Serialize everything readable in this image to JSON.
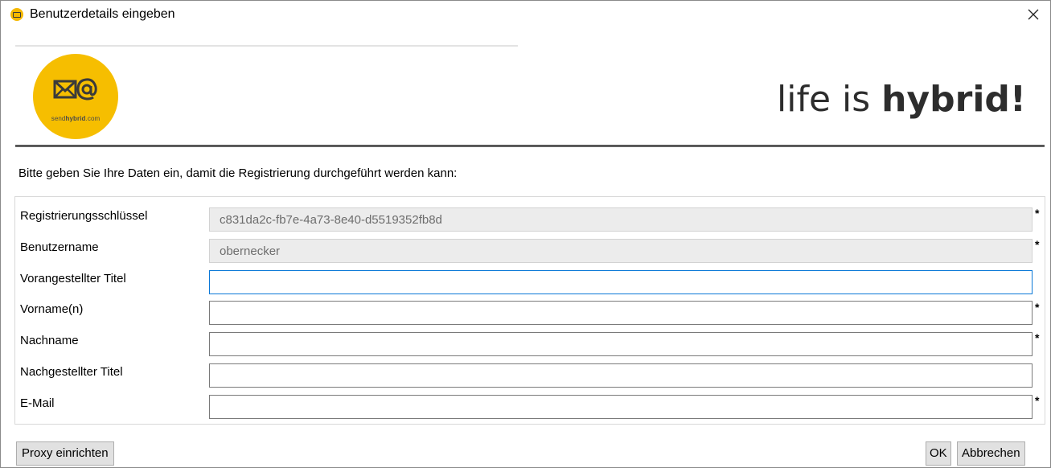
{
  "window": {
    "title": "Benutzerdetails eingeben",
    "close_glyph": "✕"
  },
  "banner": {
    "logo_text_prefix": "send",
    "logo_text_bold": "hybrid",
    "logo_text_suffix": ".com",
    "slogan_light": "life is ",
    "slogan_bold": "hybrid!",
    "brand_color": "#f6be00"
  },
  "instruction": "Bitte geben Sie Ihre Daten ein, damit die Registrierung durchgeführt werden kann:",
  "form": {
    "fields": [
      {
        "label": "Registrierungsschlüssel",
        "value": "c831da2c-fb7e-4a73-8e40-d5519352fb8d",
        "required_mark": "*"
      },
      {
        "label": "Benutzername",
        "value": "obernecker",
        "required_mark": "*"
      },
      {
        "label": "Vorangestellter Titel",
        "value": "",
        "required_mark": ""
      },
      {
        "label": "Vorname(n)",
        "value": "",
        "required_mark": "*"
      },
      {
        "label": "Nachname",
        "value": "",
        "required_mark": "*"
      },
      {
        "label": "Nachgestellter Titel",
        "value": "",
        "required_mark": ""
      },
      {
        "label": "E-Mail",
        "value": "",
        "required_mark": "*"
      }
    ]
  },
  "buttons": {
    "proxy": "Proxy einrichten",
    "ok": "OK",
    "cancel": "Abbrechen"
  },
  "icons": {
    "app": "sendhybrid-icon",
    "close": "close-icon",
    "logo": "envelope-at-icon"
  }
}
